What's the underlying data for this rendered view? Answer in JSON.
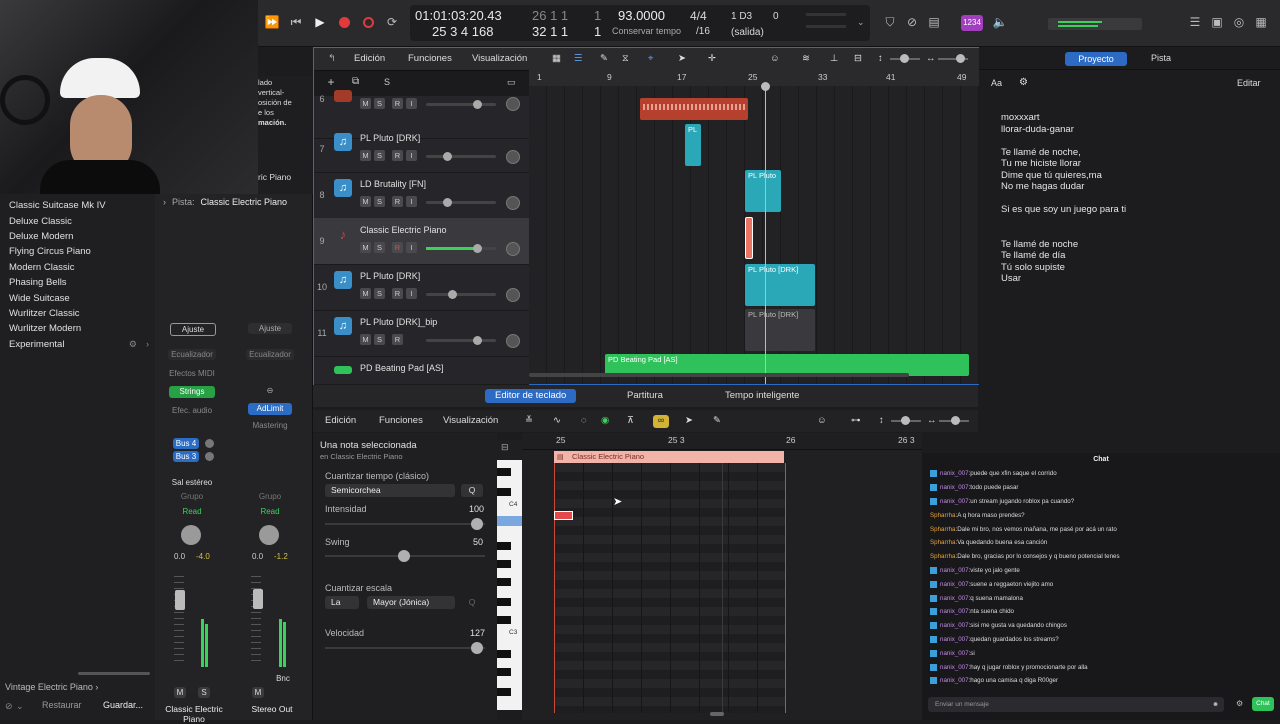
{
  "transport": {
    "time": "01:01:03:20.43",
    "bars": "25  3  4  168",
    "pos_top": "26  1  1",
    "pos_top2": "1",
    "pos_bottom": "32  1  1",
    "pos_bottom2": "1",
    "tempo": "93.0000",
    "tempo_label": "Conservar tempo",
    "signature": "4/4",
    "division": "/16",
    "key": "1 D3",
    "key_val": "0",
    "output": "(salida)",
    "badge": "1234"
  },
  "library": {
    "items": [
      "Classic Suitcase Mk IV",
      "Deluxe Classic",
      "Deluxe Modern",
      "Flying Circus Piano",
      "Modern Classic",
      "Phasing Bells",
      "Wide Suitcase",
      "Wurlitzer Classic",
      "Wurlitzer Modern",
      "Experimental"
    ],
    "footer_path": "Vintage Electric Piano",
    "restore": "Restaurar",
    "save": "Guardar..."
  },
  "webcam_overlay": {
    "lines": [
      "lado",
      "vertical-",
      "osición de",
      "e los",
      "mación."
    ],
    "tail": "ric Piano"
  },
  "inspector": {
    "track_label": "Pista:",
    "track_value": "Classic Electric Piano",
    "ajuste1": "Ajuste",
    "ajuste2": "Ajuste",
    "eq1": "Ecualizador",
    "eq2": "Ecualizador",
    "midi_fx": "Efectos MIDI",
    "strings": "Strings",
    "adlimit": "AdLimit",
    "fx_audio": "Efec. audio",
    "mastering": "Mastering",
    "bus4": "Bus 4",
    "bus3": "Bus 3",
    "sal": "Sal estéreo",
    "grupo1": "Grupo",
    "grupo2": "Grupo",
    "read1": "Read",
    "read2": "Read",
    "pan1a": "0.0",
    "pan1b": "-4.0",
    "pan2a": "0.0",
    "pan2b": "-1.2",
    "m1": "M",
    "s1": "S",
    "m2": "M",
    "bnc": "Bnc",
    "ch1": "Classic Electric Piano",
    "ch2": "Stereo Out"
  },
  "tracks_toolbar": {
    "edicion": "Edición",
    "funciones": "Funciones",
    "visualizacion": "Visualización"
  },
  "ruler": [
    "1",
    "9",
    "17",
    "25",
    "33",
    "41",
    "49"
  ],
  "tracks": [
    {
      "num": "6",
      "name": ""
    },
    {
      "num": "7",
      "name": "PL Pluto [DRK]"
    },
    {
      "num": "8",
      "name": "LD Brutality [FN]"
    },
    {
      "num": "9",
      "name": "Classic Electric Piano"
    },
    {
      "num": "10",
      "name": "PL Pluto [DRK]"
    },
    {
      "num": "11",
      "name": "PL Pluto [DRK]_bip"
    },
    {
      "num": "",
      "name": "PD Beating Pad [AS]"
    }
  ],
  "regions": {
    "r1": "PL",
    "r2": "PL Pluto",
    "r3": "PL Pluto [DRK]",
    "r4": "PL Pluto [DRK]",
    "r5": "PD Beating Pad [AS]"
  },
  "right_panel": {
    "tab_project": "Proyecto",
    "tab_track": "Pista",
    "aa": "Aa",
    "edit": "Editar",
    "lyrics": [
      "moxxxart",
      "llorar-duda-ganar",
      "",
      "Te llamé de noche,",
      "Tu me hiciste llorar",
      "Dime que tú quieres,ma",
      "No me hagas dudar",
      "",
      "Si es que soy un juego para ti",
      "",
      "",
      "Te llamé de noche",
      "Te llamé de día",
      "Tú solo supiste",
      "Usar"
    ]
  },
  "editor_tabs": {
    "piano_roll": "Editor de teclado",
    "score": "Partitura",
    "smart_tempo": "Tempo inteligente"
  },
  "editor_toolbar": {
    "edicion": "Edición",
    "funciones": "Funciones",
    "visualizacion": "Visualización"
  },
  "editor_side": {
    "selected": "Una nota seleccionada",
    "selected_sub": "en Classic Electric Piano",
    "quant_time": "Cuantizar tiempo (clásico)",
    "quant_val": "Semicorchea",
    "q1": "Q",
    "intensity": "Intensidad",
    "intensity_val": "100",
    "swing": "Swing",
    "swing_val": "50",
    "quant_scale": "Cuantizar escala",
    "scale_root": "La",
    "scale_mode": "Mayor (Jónica)",
    "q2": "Q",
    "velocity": "Velocidad",
    "velocity_val": "127"
  },
  "piano_roll": {
    "ruler": [
      "25",
      "25 3",
      "26",
      "26 3"
    ],
    "region": "Classic Electric Piano",
    "c4": "C4",
    "c3": "C3"
  },
  "chat": {
    "title": "Chat",
    "input_placeholder": "Enviar un mensaje",
    "send": "Chat",
    "messages": [
      {
        "user": "nanix_007",
        "text": "puede que xfin saque el corrido"
      },
      {
        "user": "nanix_007",
        "text": "todo puede pasar"
      },
      {
        "user": "nanix_007",
        "text": "un stream jugando roblox pa cuando?"
      },
      {
        "user": "Spharrha",
        "text": "A q hora maso prendes?"
      },
      {
        "user": "Spharrha",
        "text": "Dale mi bro, nos vemos mañana, me pasé por acá un rato"
      },
      {
        "user": "Spharrha",
        "text": "Va quedando buena esa canción"
      },
      {
        "user": "Spharrha",
        "text": "Dale bro, gracias por lo consejos y q bueno potencial tenes"
      },
      {
        "user": "nanix_007",
        "text": "viste yo jalo gente"
      },
      {
        "user": "nanix_007",
        "text": "suene a reggaeton viejito amo"
      },
      {
        "user": "nanix_007",
        "text": "q suena mamalona"
      },
      {
        "user": "nanix_007",
        "text": "nta suena chido"
      },
      {
        "user": "nanix_007",
        "text": "sisi me gusta va quedando chingos"
      },
      {
        "user": "nanix_007",
        "text": "quedan guardados los streams?"
      },
      {
        "user": "nanix_007",
        "text": "si"
      },
      {
        "user": "nanix_007",
        "text": "hay q jugar roblox y promocionarte por alla"
      },
      {
        "user": "nanix_007",
        "text": "hago una camisa q diga R00ger"
      }
    ]
  },
  "colors": {
    "accent_blue": "#2c6ac4",
    "teal": "#2aa8b8",
    "green": "#2fc25b",
    "red_region": "#b5402e"
  }
}
